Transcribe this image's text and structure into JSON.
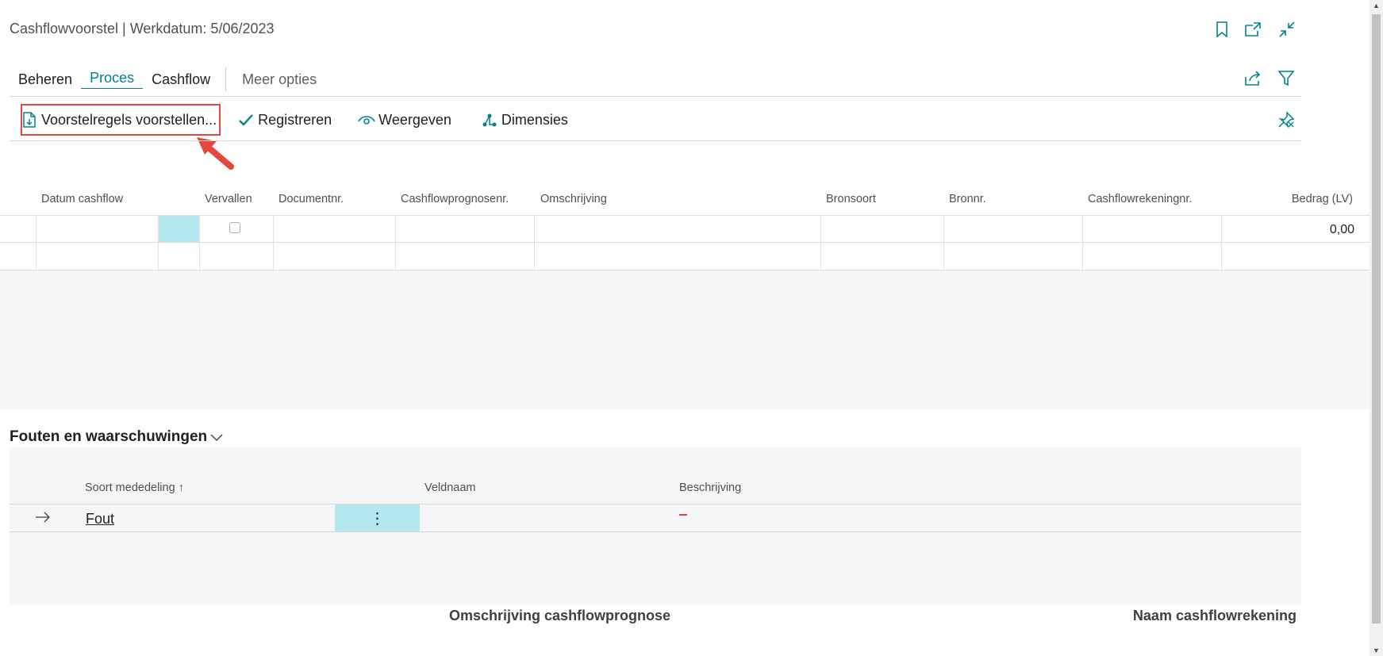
{
  "header": {
    "title": "Cashflowvoorstel | Werkdatum: 5/06/2023",
    "icons": [
      "bookmark-icon",
      "open-new-window-icon",
      "collapse-icon"
    ]
  },
  "menu": {
    "items": [
      {
        "label": "Beheren",
        "active": false
      },
      {
        "label": "Proces",
        "active": true
      },
      {
        "label": "Cashflow",
        "active": false
      }
    ],
    "more_label": "Meer opties",
    "right_icons": [
      "share-icon",
      "filter-icon"
    ]
  },
  "actions": {
    "items": [
      {
        "label": "Voorstelregels voorstellen...",
        "icon": "document-icon"
      },
      {
        "label": "Registreren",
        "icon": "checkmark-icon"
      },
      {
        "label": "Weergeven",
        "icon": "eye-icon"
      },
      {
        "label": "Dimensies",
        "icon": "dimensions-icon"
      }
    ],
    "pin_icon": "pin-icon"
  },
  "grid": {
    "columns": [
      "Datum cashflow",
      "Vervallen",
      "Documentnr.",
      "Cashflowprognosenr.",
      "Omschrijving",
      "Bronsoort",
      "Bronnr.",
      "Cashflowrekeningnr.",
      "Bedrag (LV)"
    ],
    "rows": [
      {
        "datum": "",
        "vervallen": false,
        "documentnr": "",
        "prognosenr": "",
        "omschrijving": "",
        "bronsoort": "",
        "bronnr": "",
        "rekeningnr": "",
        "bedrag": "0,00"
      }
    ]
  },
  "errors_section": {
    "title": "Fouten en waarschuwingen",
    "columns": [
      "Soort mededeling",
      "Veldnaam",
      "Beschrijving"
    ],
    "sort_indicator": "↑",
    "rows": [
      {
        "soort": "Fout",
        "veldnaam": "",
        "beschrijving": ""
      }
    ],
    "row_menu": "⋮"
  },
  "footer": {
    "left_label": "Omschrijving cashflowprognose",
    "right_label": "Naam cashflowrekening"
  },
  "colors": {
    "accent": "#00838f",
    "highlight": "#e0493f",
    "selection": "#b3e8ee"
  }
}
